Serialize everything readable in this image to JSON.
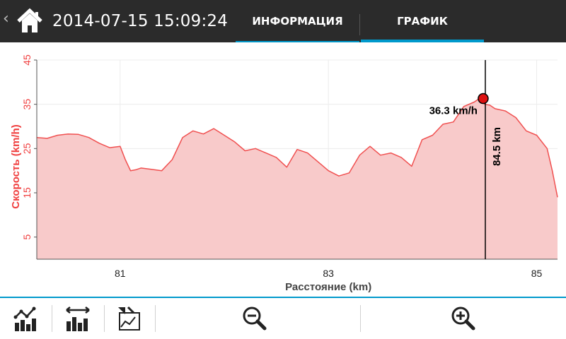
{
  "header": {
    "back_icon": "chevron-left-icon",
    "home_icon": "home-icon",
    "title": "2014-07-15 15:09:24",
    "tabs": [
      {
        "label": "ИНФОРМАЦИЯ",
        "active": false
      },
      {
        "label": "ГРАФИК",
        "active": true
      }
    ]
  },
  "colors": {
    "accent": "#0099cc",
    "topbar": "#2b2b2b",
    "series_line": "#f05050",
    "series_fill": "#f8caca",
    "axis_text": "#f04040",
    "marker": "#dd1111"
  },
  "chart_data": {
    "type": "area",
    "xlabel": "Расстояние (km)",
    "ylabel": "Скорость (km/h)",
    "xlim": [
      80.2,
      85.2
    ],
    "ylim": [
      0,
      45
    ],
    "x_ticks": [
      81,
      83,
      85
    ],
    "y_ticks": [
      5,
      15,
      25,
      35,
      45
    ],
    "grid": true,
    "series": [
      {
        "x": [
          80.2,
          80.3,
          80.4,
          80.5,
          80.6,
          80.7,
          80.8,
          80.9,
          81.0,
          81.05,
          81.1,
          81.15,
          81.2,
          81.3,
          81.4,
          81.5,
          81.6,
          81.7,
          81.8,
          81.9,
          82.0,
          82.1,
          82.2,
          82.3,
          82.4,
          82.5,
          82.6,
          82.7,
          82.8,
          82.9,
          83.0,
          83.1,
          83.2,
          83.3,
          83.4,
          83.5,
          83.6,
          83.7,
          83.8,
          83.9,
          84.0,
          84.1,
          84.2,
          84.3,
          84.4,
          84.45,
          84.5,
          84.55,
          84.6,
          84.7,
          84.8,
          84.9,
          85.0,
          85.1,
          85.15,
          85.2
        ],
        "y": [
          27.5,
          27.3,
          28.0,
          28.3,
          28.2,
          27.5,
          26.2,
          25.2,
          25.5,
          22.5,
          20.0,
          20.2,
          20.6,
          20.3,
          20.0,
          22.5,
          27.5,
          29.0,
          28.3,
          29.5,
          28.0,
          26.5,
          24.5,
          25.0,
          24.0,
          23.0,
          20.8,
          24.8,
          24.0,
          22.0,
          20.0,
          18.8,
          19.5,
          23.5,
          25.5,
          23.5,
          24.0,
          23.0,
          21.0,
          27.0,
          28.0,
          30.5,
          31.0,
          34.5,
          35.5,
          36.3,
          35.0,
          34.8,
          34.0,
          33.5,
          32.0,
          29.0,
          28.0,
          25.0,
          20.0,
          14.0
        ]
      }
    ],
    "marker": {
      "x": 84.5,
      "y": 36.3,
      "speed_label": "36.3 km/h",
      "distance_label": "84.5 km"
    }
  },
  "toolbar": {
    "buttons": [
      {
        "icon": "line-bar-chart-icon"
      },
      {
        "icon": "range-bar-chart-icon"
      },
      {
        "icon": "map-chart-icon"
      },
      {
        "icon": "zoom-out-icon"
      },
      {
        "icon": "zoom-in-icon"
      }
    ]
  }
}
